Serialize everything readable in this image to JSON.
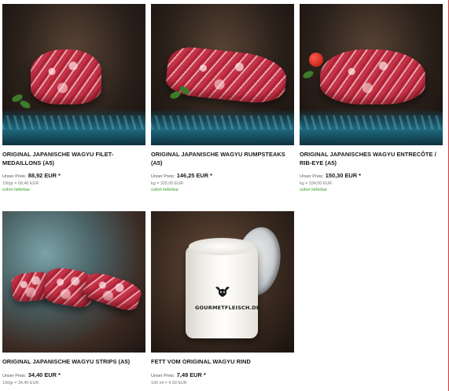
{
  "products": [
    {
      "title": "ORIGINAL JAPANISCHE WAGYU FILET-MEDAILLONS (A5)",
      "price_label": "Unser Preis:",
      "price": "88,92 EUR *",
      "unit_price": "100gr = 68,40 EUR",
      "availability": "sofort lieferbar"
    },
    {
      "title": "ORIGINAL JAPANISCHE WAGYU RUMPSTEAKS (A5)",
      "price_label": "Unser Preis:",
      "price": "146,25 EUR *",
      "unit_price": "kg = 325,00 EUR",
      "availability": "sofort lieferbar"
    },
    {
      "title": "ORIGINAL JAPANISCHES WAGYU ENTRECÔTE / RIB-EYE (A5)",
      "price_label": "Unser Preis:",
      "price": "150,30 EUR *",
      "unit_price": "kg = 334,00 EUR",
      "availability": "sofort lieferbar"
    },
    {
      "title": "ORIGINAL JAPANISCHE WAGYU STRIPS (A5)",
      "price_label": "Unser Preis:",
      "price": "34,40 EUR *",
      "unit_price": "100gr = 34,40 EUR",
      "availability": ""
    },
    {
      "title": "FETT VOM ORIGINAL WAGYU RIND",
      "price_label": "Unser Preis:",
      "price": "7,49 EUR *",
      "unit_price": "100 ml = 4,99 EUR",
      "availability": ""
    }
  ],
  "jar": {
    "brand": "GOURMETFLEISCH.DE"
  },
  "colors": {
    "availability": "#3a9a2a",
    "frame": "#d23a3a",
    "teal_band": "#1f6f86"
  },
  "icons": [
    "bull-icon"
  ]
}
